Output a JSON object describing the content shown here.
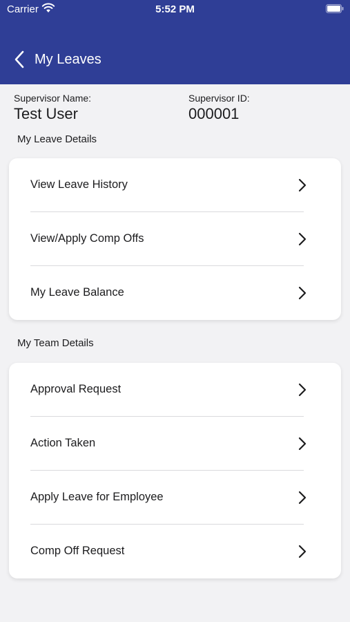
{
  "status_bar": {
    "carrier": "Carrier",
    "time": "5:52 PM"
  },
  "nav": {
    "title": "My Leaves"
  },
  "supervisor": {
    "name_label": "Supervisor Name:",
    "name_value": "Test User",
    "id_label": "Supervisor ID:",
    "id_value": "000001"
  },
  "leave_section": {
    "title": "My Leave Details",
    "items": [
      {
        "label": "View Leave History"
      },
      {
        "label": "View/Apply Comp Offs"
      },
      {
        "label": "My Leave Balance"
      }
    ]
  },
  "team_section": {
    "title": "My Team Details",
    "items": [
      {
        "label": "Approval Request"
      },
      {
        "label": "Action Taken"
      },
      {
        "label": "Apply Leave for Employee"
      },
      {
        "label": "Comp Off Request"
      }
    ]
  },
  "colors": {
    "header": "#2f3e96",
    "background": "#f2f2f4",
    "card": "#ffffff"
  }
}
